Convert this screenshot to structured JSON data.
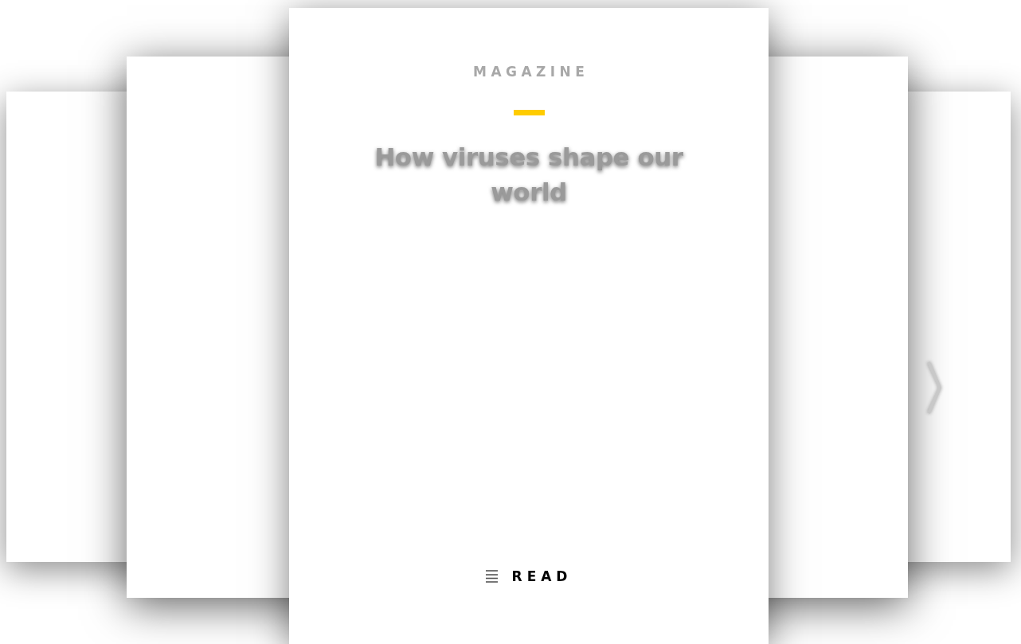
{
  "front_card": {
    "category": "MAGAZINE",
    "title": "How viruses shape our world",
    "action": "READ"
  }
}
